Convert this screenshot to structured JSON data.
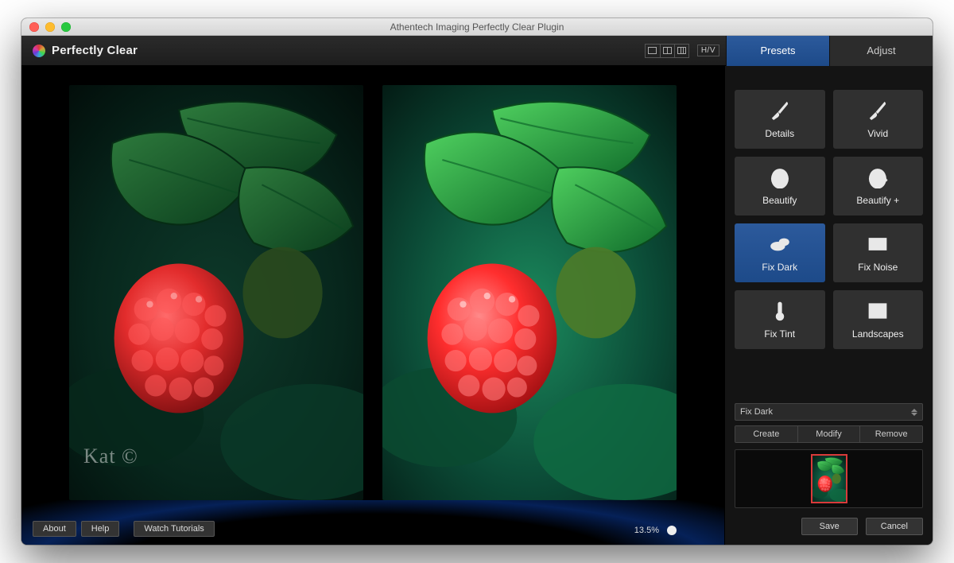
{
  "window_title": "Athentech Imaging Perfectly Clear Plugin",
  "brand": {
    "name": "Perfectly Clear"
  },
  "view_toolbar": {
    "hv_label": "H/V"
  },
  "tabs": {
    "presets": "Presets",
    "adjust": "Adjust",
    "active": "presets"
  },
  "presets": [
    {
      "id": "details",
      "label": "Details",
      "icon": "brush"
    },
    {
      "id": "vivid",
      "label": "Vivid",
      "icon": "brush"
    },
    {
      "id": "beautify",
      "label": "Beautify",
      "icon": "face"
    },
    {
      "id": "beautifyp",
      "label": "Beautify +",
      "icon": "face-plus"
    },
    {
      "id": "fixdark",
      "label": "Fix Dark",
      "icon": "clouds",
      "active": true
    },
    {
      "id": "fixnoise",
      "label": "Fix Noise",
      "icon": "noise"
    },
    {
      "id": "fixtint",
      "label": "Fix Tint",
      "icon": "thermometer"
    },
    {
      "id": "landscapes",
      "label": "Landscapes",
      "icon": "mountains"
    }
  ],
  "preset_select": {
    "value": "Fix Dark"
  },
  "preset_actions": {
    "create": "Create",
    "modify": "Modify",
    "remove": "Remove"
  },
  "footer": {
    "about": "About",
    "help": "Help",
    "tutorials": "Watch Tutorials",
    "zoom": "13.5%"
  },
  "actions": {
    "save": "Save",
    "cancel": "Cancel"
  },
  "watermark": "Kat ©"
}
